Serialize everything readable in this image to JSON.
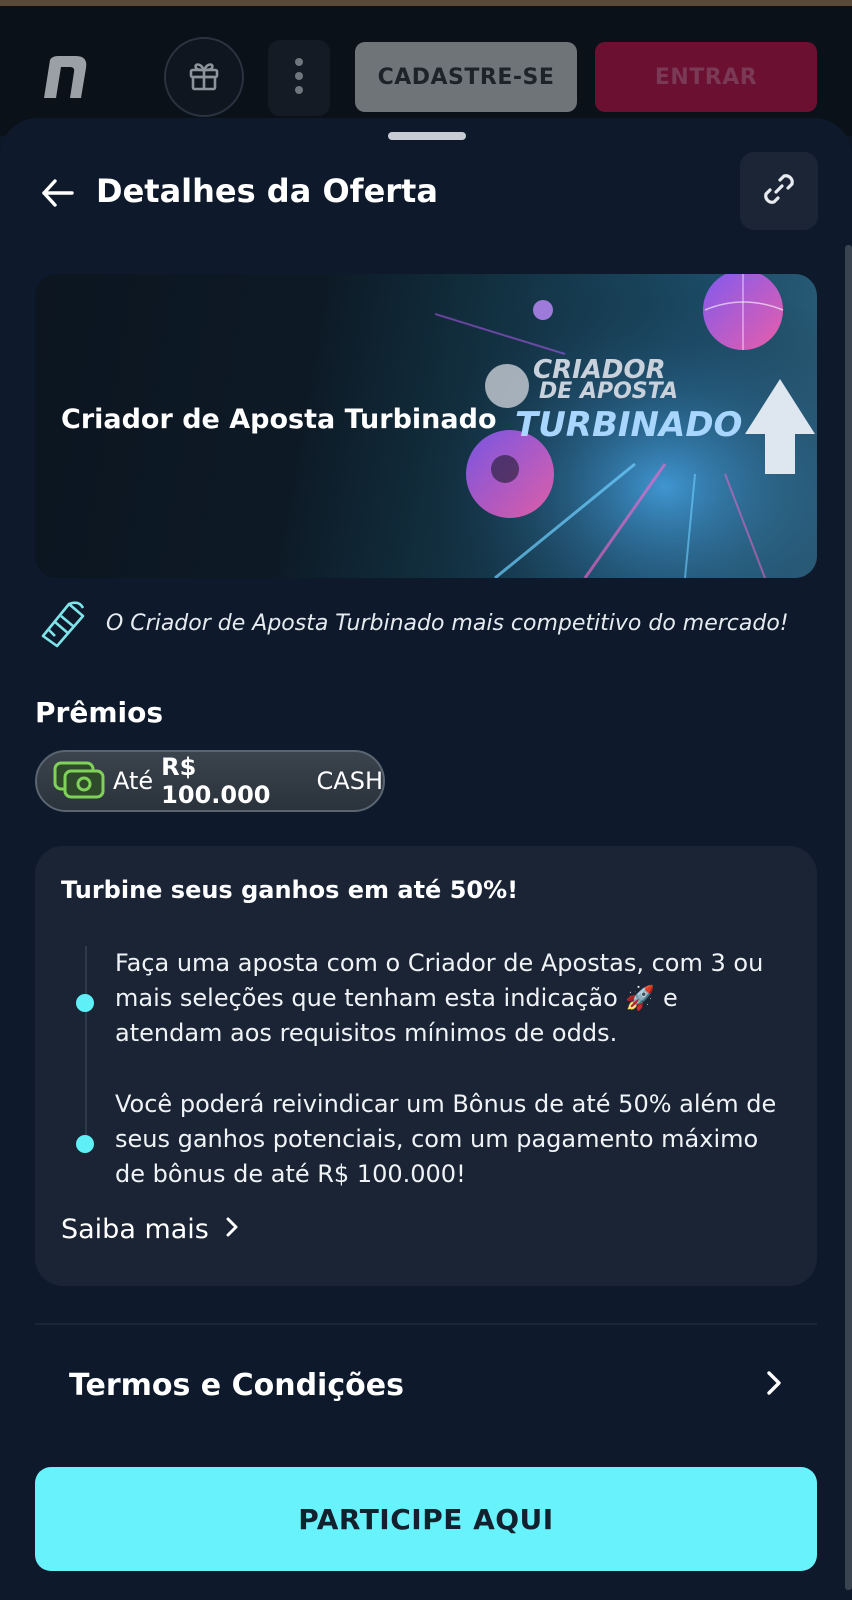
{
  "header": {
    "signup_label": "CADASTRE-SE",
    "login_label": "ENTRAR"
  },
  "page": {
    "title": "Detalhes da Oferta"
  },
  "banner": {
    "title": "Criador de Aposta Turbinado",
    "art_line1": "CRIADOR",
    "art_line2": "DE APOSTA",
    "art_line3": "TURBINADO"
  },
  "description": "O Criador de Aposta Turbinado mais competitivo do mercado!",
  "prizes": {
    "title": "Prêmios",
    "prefix": "Até",
    "amount": "R$ 100.000",
    "currency": "CASH"
  },
  "info_card": {
    "heading": "Turbine seus ganhos em até 50%!",
    "steps": [
      "Faça uma aposta com o Criador de Apostas, com 3 ou mais seleções que tenham esta indicação 🚀 e atendam aos requisitos mínimos de odds.",
      "Você poderá reivindicar um Bônus de até 50% além de seus ganhos potenciais, com um pagamento máximo de bônus de até R$ 100.000!"
    ],
    "learn_more": "Saiba mais"
  },
  "terms_label": "Termos e Condições",
  "cta_label": "PARTICIPE AQUI",
  "colors": {
    "background": "#0e1a2b",
    "accent": "#68f2fb",
    "login_button": "#6b1030",
    "signup_button": "#6f7479"
  }
}
